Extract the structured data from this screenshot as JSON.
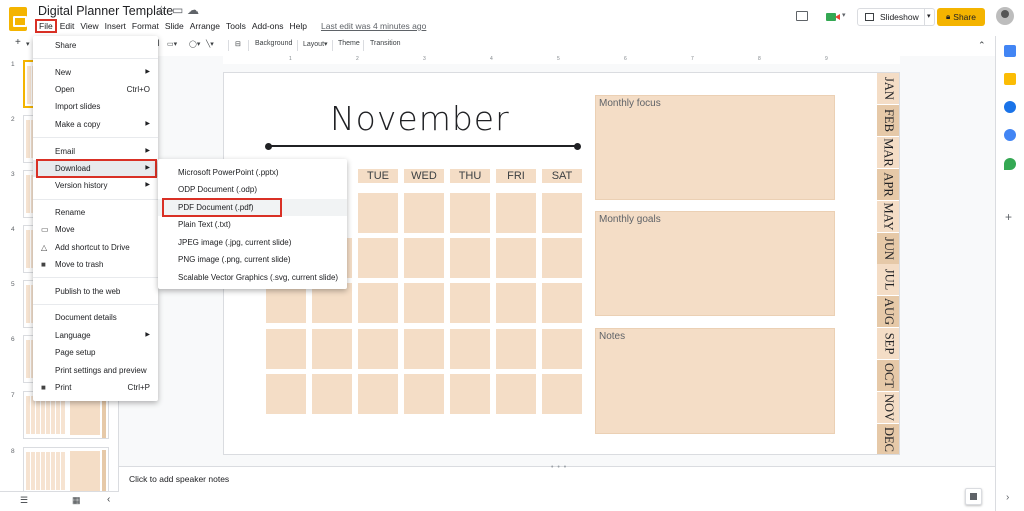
{
  "header": {
    "doc_title": "Digital Planner Template",
    "menu": [
      "File",
      "Edit",
      "View",
      "Insert",
      "Format",
      "Slide",
      "Arrange",
      "Tools",
      "Add-ons",
      "Help"
    ],
    "last_edit": "Last edit was 4 minutes ago",
    "slideshow_label": "Slideshow",
    "share_label": "Share"
  },
  "toolbar": {
    "background_label": "Background",
    "layout_label": "Layout▾",
    "theme_label": "Theme",
    "transition_label": "Transition"
  },
  "file_menu": {
    "share": "Share",
    "new": "New",
    "open": "Open",
    "open_shortcut": "Ctrl+O",
    "import_slides": "Import slides",
    "make_a_copy": "Make a copy",
    "email": "Email",
    "download": "Download",
    "version_history": "Version history",
    "rename": "Rename",
    "move": "Move",
    "add_shortcut": "Add shortcut to Drive",
    "move_to_trash": "Move to trash",
    "publish": "Publish to the web",
    "document_details": "Document details",
    "language": "Language",
    "page_setup": "Page setup",
    "print_settings": "Print settings and preview",
    "print": "Print",
    "print_shortcut": "Ctrl+P"
  },
  "download_menu": [
    "Microsoft PowerPoint (.pptx)",
    "ODP Document (.odp)",
    "PDF Document (.pdf)",
    "Plain Text (.txt)",
    "JPEG image (.jpg, current slide)",
    "PNG image (.png, current slide)",
    "Scalable Vector Graphics (.svg, current slide)"
  ],
  "filmstrip": {
    "slide_numbers": [
      "1",
      "2",
      "3",
      "4",
      "5",
      "6",
      "7",
      "8"
    ]
  },
  "ruler_numbers": [
    "1",
    "2",
    "3",
    "4",
    "5",
    "6",
    "7",
    "8",
    "9"
  ],
  "slide": {
    "month_title": "November",
    "visible_day_headers": [
      "TUE",
      "WED",
      "THU",
      "FRI",
      "SAT"
    ],
    "panels": [
      "Monthly focus",
      "Monthly goals",
      "Notes"
    ],
    "month_tabs": [
      "JAN",
      "FEB",
      "MAR",
      "APR",
      "MAY",
      "JUN",
      "JUL",
      "AUG",
      "SEP",
      "OCT",
      "NOV",
      "DEC"
    ]
  },
  "speaker_notes": {
    "placeholder": "Click to add speaker notes"
  },
  "colors": {
    "accent_yellow": "#f4b400",
    "highlight_red": "#d93025",
    "planner_peach": "#f4ddc6",
    "tab_dark": "#e6c9a8",
    "tab_light": "#f4ddc6"
  },
  "icons": [
    "slides-logo",
    "star-icon",
    "folder-move-icon",
    "cloud-saved-icon",
    "comments-icon",
    "meet-icon",
    "slideshow-icon",
    "lock-icon",
    "account-avatar",
    "calendar-icon",
    "keep-icon",
    "tasks-icon",
    "contacts-icon",
    "maps-icon",
    "add-icon",
    "expand-panel-icon",
    "explore-icon"
  ]
}
